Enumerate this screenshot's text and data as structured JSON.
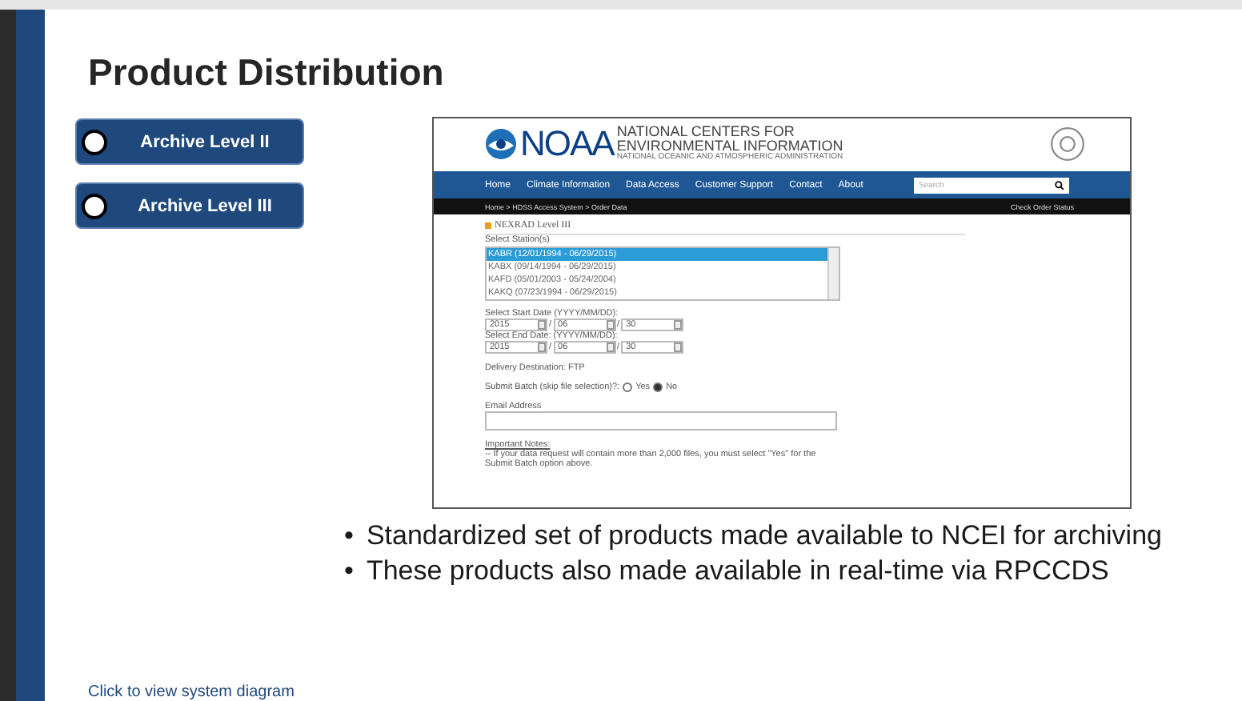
{
  "title": "Product Distribution",
  "archive_buttons": [
    {
      "label": "Archive Level II",
      "selected": false
    },
    {
      "label": "Archive Level III",
      "selected": false
    }
  ],
  "screenshot": {
    "org_name": "NOAA",
    "header_line1": "NATIONAL CENTERS FOR",
    "header_line2": "ENVIRONMENTAL INFORMATION",
    "header_subline": "NATIONAL OCEANIC AND ATMOSPHERIC ADMINISTRATION",
    "nav": [
      "Home",
      "Climate Information",
      "Data Access",
      "Customer Support",
      "Contact",
      "About"
    ],
    "search_placeholder": "Search",
    "breadcrumb": "Home > HDSS Access System > Order Data",
    "check_status": "Check Order Status",
    "section_title": "NEXRAD Level III",
    "stations_label": "Select Station(s)",
    "stations": [
      {
        "text": "KABR (12/01/1994 - 06/29/2015)",
        "selected": true
      },
      {
        "text": "KABX (09/14/1994 - 06/29/2015)",
        "selected": false
      },
      {
        "text": "KAFD (05/01/2003 - 05/24/2004)",
        "selected": false
      },
      {
        "text": "KAKQ (07/23/1994 - 06/29/2015)",
        "selected": false
      }
    ],
    "start_label": "Select Start Date (YYYY/MM/DD):",
    "start": [
      "2015",
      "06",
      "30"
    ],
    "start_separators": [
      "/",
      "/"
    ],
    "end_label": "Select End Date: (YYYY/MM/DD):",
    "end": [
      "2015",
      "06",
      "30"
    ],
    "end_separators": [
      "/",
      "/"
    ],
    "delivery": "Delivery Destination: FTP",
    "batch_label": "Submit Batch (skip file selection)?:",
    "batch_options": [
      {
        "label": "Yes",
        "selected": false
      },
      {
        "label": "No",
        "selected": true
      }
    ],
    "email_label": "Email Address",
    "notes_heading": "Important Notes:",
    "note": "-- If your data request will contain more than 2,000 files, you must select \"Yes\" for the Submit Batch option above."
  },
  "bullets": [
    {
      "marker": "•",
      "text": "Standardized set of products made available to NCEI for archiving"
    },
    {
      "marker": "•",
      "text": "These products also made available in real-time via RPCCDS"
    }
  ],
  "diagram_link": "Click to view system diagram"
}
